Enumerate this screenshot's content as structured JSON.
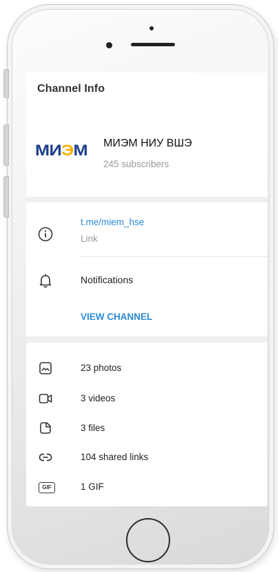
{
  "header": {
    "title": "Channel Info"
  },
  "channel": {
    "logo_part1": "МИ",
    "logo_part2": "Э",
    "logo_part3": "М",
    "name": "МИЭМ НИУ ВШЭ",
    "subscribers": "245 subscribers"
  },
  "info": {
    "link": "t.me/miem_hse",
    "link_label": "Link",
    "notifications_label": "Notifications",
    "view_channel_label": "VIEW CHANNEL"
  },
  "media": [
    {
      "icon": "photo-icon",
      "label": "23 photos"
    },
    {
      "icon": "video-icon",
      "label": "3 videos"
    },
    {
      "icon": "file-icon",
      "label": "3 files"
    },
    {
      "icon": "link-icon",
      "label": "104 shared links"
    },
    {
      "icon": "gif-icon",
      "icon_text": "GIF",
      "label": "1 GIF"
    }
  ],
  "colors": {
    "accent": "#2b8ad6",
    "logo_blue": "#1d3f8c",
    "logo_yellow": "#f4b000"
  }
}
